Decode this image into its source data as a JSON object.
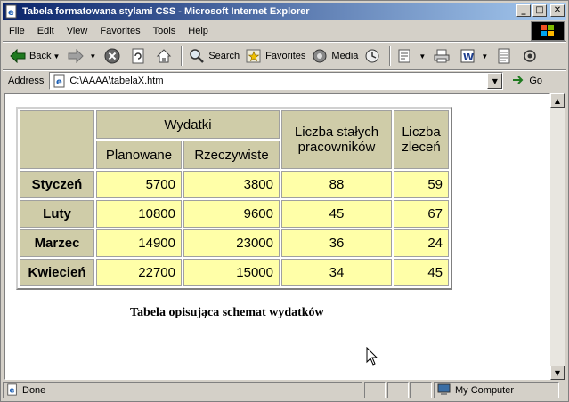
{
  "window": {
    "title": "Tabela formatowana stylami CSS - Microsoft Internet Explorer"
  },
  "menu": [
    "File",
    "Edit",
    "View",
    "Favorites",
    "Tools",
    "Help"
  ],
  "toolbar": {
    "back": "Back",
    "search": "Search",
    "favorites": "Favorites",
    "media": "Media"
  },
  "address": {
    "label": "Address",
    "value": "C:\\AAAA\\tabelaX.htm",
    "go": "Go"
  },
  "table": {
    "header": {
      "group": "Wydatki",
      "planned": "Planowane",
      "actual": "Rzeczywiste",
      "staff_line1": "Liczba stałych",
      "staff_line2": "pracowników",
      "orders_line1": "Liczba",
      "orders_line2": "zleceń"
    },
    "rows": [
      {
        "month": "Styczeń",
        "planned": "5700",
        "actual": "3800",
        "staff": "88",
        "orders": "59"
      },
      {
        "month": "Luty",
        "planned": "10800",
        "actual": "9600",
        "staff": "45",
        "orders": "67"
      },
      {
        "month": "Marzec",
        "planned": "14900",
        "actual": "23000",
        "staff": "36",
        "orders": "24"
      },
      {
        "month": "Kwiecień",
        "planned": "22700",
        "actual": "15000",
        "staff": "34",
        "orders": "45"
      }
    ],
    "caption": "Tabela opisująca schemat wydatków"
  },
  "status": {
    "text": "Done",
    "zone": "My Computer"
  },
  "colors": {
    "header_bg": "#cfcca8",
    "cell_bg": "#ffffa8",
    "titlebar": "#0a246a"
  }
}
